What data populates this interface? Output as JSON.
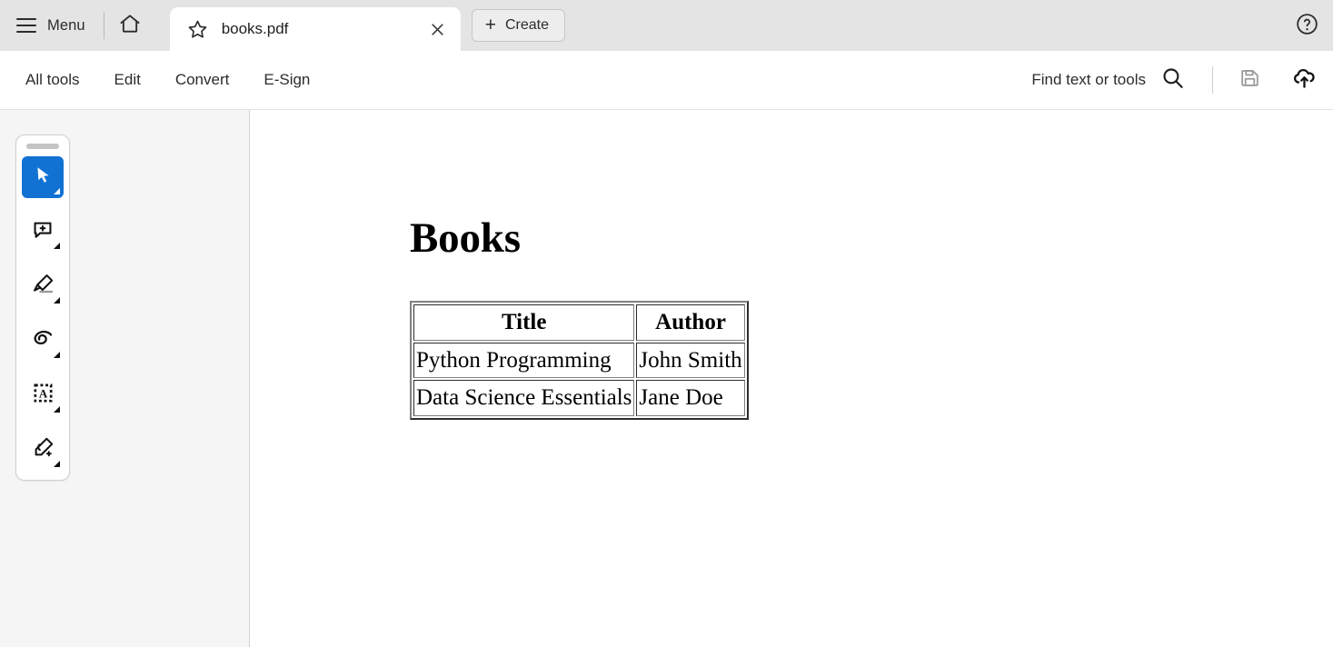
{
  "window": {
    "menu_label": "Menu",
    "home_icon": "home-icon",
    "help_icon": "help-circle-icon"
  },
  "tab": {
    "star_icon": "star-outline-icon",
    "title": "books.pdf",
    "close_icon": "close-icon"
  },
  "create_button": {
    "plus": "+",
    "label": "Create"
  },
  "commandbar": {
    "items": [
      {
        "label": "All tools",
        "name": "all-tools"
      },
      {
        "label": "Edit",
        "name": "edit"
      },
      {
        "label": "Convert",
        "name": "convert"
      },
      {
        "label": "E-Sign",
        "name": "e-sign"
      }
    ],
    "find_label": "Find text or tools",
    "search_icon": "search-icon",
    "save_icon": "save-disk-icon",
    "upload_icon": "cloud-upload-icon"
  },
  "quick_tools": {
    "grip": "drag-handle",
    "items": [
      {
        "name": "select-tool",
        "icon": "cursor-arrow-icon",
        "active": true
      },
      {
        "name": "add-comment-tool",
        "icon": "comment-plus-icon",
        "active": false
      },
      {
        "name": "highlight-tool",
        "icon": "highlighter-icon",
        "active": false
      },
      {
        "name": "draw-tool",
        "icon": "freehand-loop-icon",
        "active": false
      },
      {
        "name": "add-text-tool",
        "icon": "text-box-a-icon",
        "active": false
      },
      {
        "name": "fill-and-sign-tool",
        "icon": "sign-pen-icon",
        "active": false
      }
    ]
  },
  "document": {
    "heading": "Books",
    "table": {
      "headers": [
        "Title",
        "Author"
      ],
      "rows": [
        [
          "Python Programming",
          "John Smith"
        ],
        [
          "Data Science Essentials",
          "Jane Doe"
        ]
      ]
    }
  },
  "colors": {
    "accent_blue": "#1172d4",
    "tabbar_bg": "#e4e4e4",
    "leftpane_bg": "#f5f5f5",
    "text": "#2c2c2c"
  }
}
